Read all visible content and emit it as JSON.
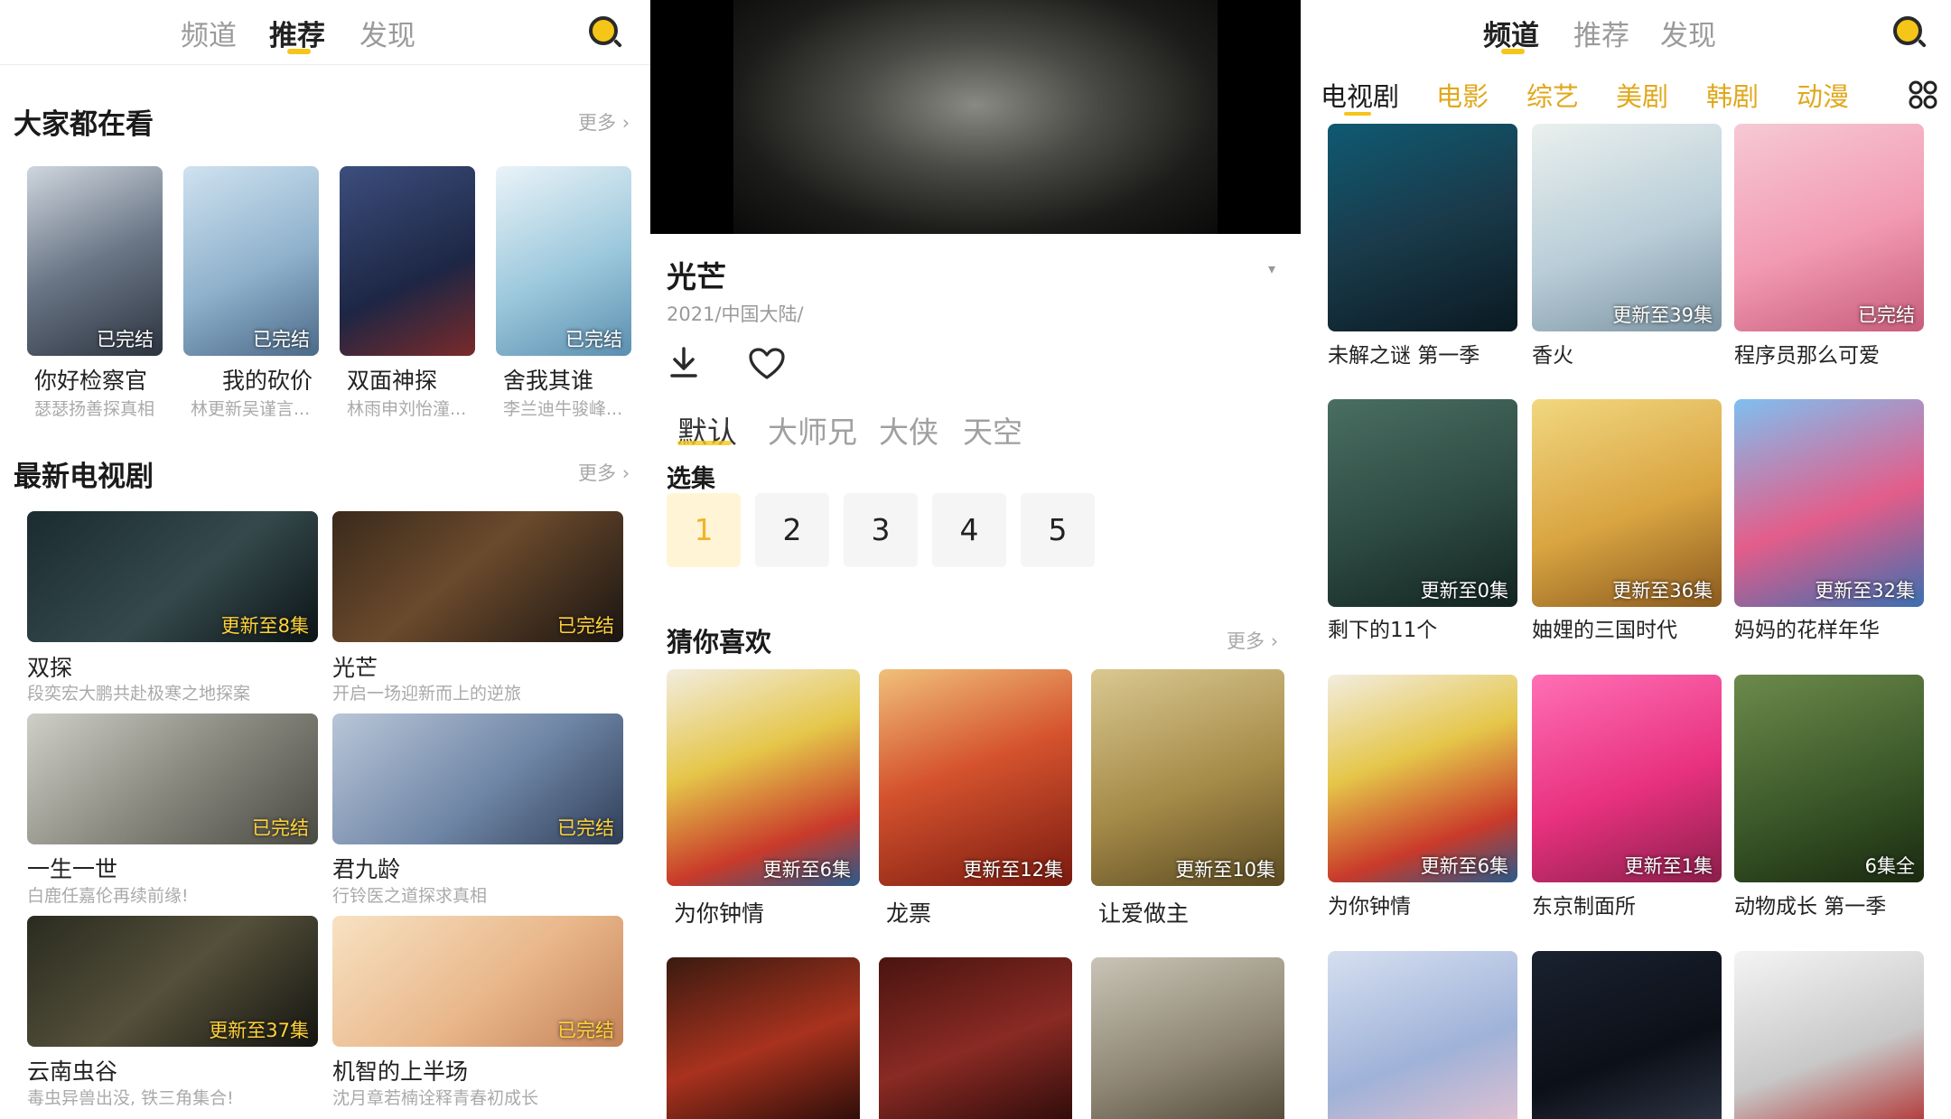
{
  "panel1": {
    "tabs": [
      "频道",
      "推荐",
      "发现"
    ],
    "section1": {
      "title": "大家都在看",
      "more": "更多",
      "items": [
        {
          "title": "你好检察官",
          "sub": "瑟瑟扬善探真相",
          "badge": "已完结"
        },
        {
          "title": "我的砍价",
          "sub": "林更新吴谨言...",
          "badge": "已完结"
        },
        {
          "title": "双面神探",
          "sub": "林雨申刘怡潼...",
          "badge": ""
        },
        {
          "title": "舍我其谁",
          "sub": "李兰迪牛骏峰...",
          "badge": "已完结"
        }
      ]
    },
    "section2": {
      "title": "最新电视剧",
      "more": "更多",
      "items": [
        {
          "title": "双探",
          "sub": "段奕宏大鹏共赴极寒之地探案",
          "badge": "更新至8集"
        },
        {
          "title": "光芒",
          "sub": "开启一场迎新而上的逆旅",
          "badge": "已完结"
        },
        {
          "title": "一生一世",
          "sub": "白鹿任嘉伦再续前缘!",
          "badge": "已完结"
        },
        {
          "title": "君九龄",
          "sub": "行铃医之道探求真相",
          "badge": "已完结"
        },
        {
          "title": "云南虫谷",
          "sub": "毒虫异兽出没, 铁三角集合!",
          "badge": "更新至37集"
        },
        {
          "title": "机智的上半场",
          "sub": "沈月章若楠诠释青春初成长",
          "badge": "已完结"
        }
      ]
    }
  },
  "panel2": {
    "title": "光芒",
    "meta": "2021/中国大陆/",
    "sources": [
      "默认",
      "大师兄",
      "大侠",
      "天空"
    ],
    "episodes_label": "选集",
    "episodes": [
      "1",
      "2",
      "3",
      "4",
      "5"
    ],
    "guess": {
      "title": "猜你喜欢",
      "more": "更多",
      "items": [
        {
          "title": "为你钟情",
          "badge": "更新至6集"
        },
        {
          "title": "龙票",
          "badge": "更新至12集"
        },
        {
          "title": "让爱做主",
          "badge": "更新至10集"
        }
      ]
    }
  },
  "panel3": {
    "tabs": [
      "频道",
      "推荐",
      "发现"
    ],
    "categories": [
      "电视剧",
      "电影",
      "综艺",
      "美剧",
      "韩剧",
      "动漫"
    ],
    "items": [
      {
        "title": "未解之谜 第一季",
        "badge": ""
      },
      {
        "title": "香火",
        "badge": "更新至39集"
      },
      {
        "title": "程序员那么可爱",
        "badge": "已完结"
      },
      {
        "title": "剩下的11个",
        "badge": "更新至0集"
      },
      {
        "title": "妯娌的三国时代",
        "badge": "更新至36集"
      },
      {
        "title": "妈妈的花样年华",
        "badge": "更新至32集"
      },
      {
        "title": "为你钟情",
        "badge": "更新至6集"
      },
      {
        "title": "东京制面所",
        "badge": "更新至1集"
      },
      {
        "title": "动物成长 第一季",
        "badge": "6集全"
      }
    ]
  }
}
